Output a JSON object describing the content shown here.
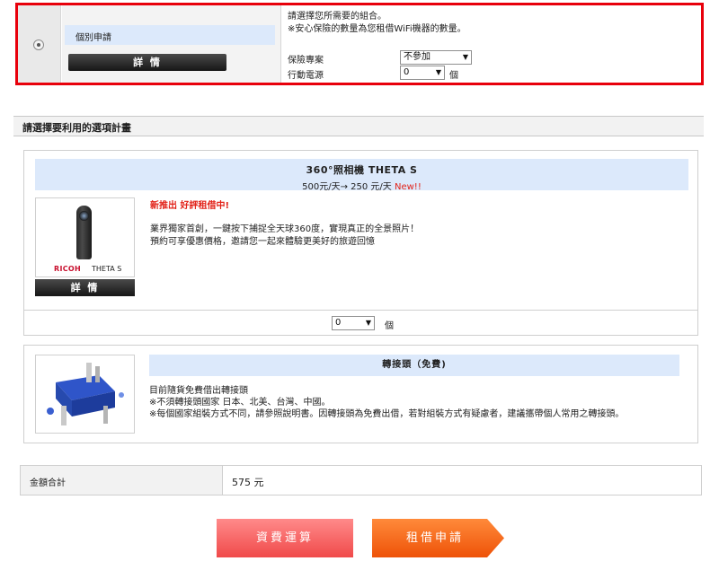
{
  "plan": {
    "name": "個別申請",
    "detail_label": "詳 情",
    "instruction_1": "請選擇您所需要的組合。",
    "instruction_2": "※安心保險的數量為您租借WiFi機器的數量。",
    "insurance_label": "保險專案",
    "insurance_value": "不參加",
    "battery_label": "行動電源",
    "battery_value": "0",
    "battery_unit": "個"
  },
  "options_section": {
    "title": "請選擇要利用的選項計畫"
  },
  "product": {
    "title": "360°照相機 THETA S",
    "price": "500元/天→ 250 元/天",
    "new_badge": "New!!",
    "image_brand": "RICOH",
    "image_model": "THETA S",
    "detail_label": "詳 情",
    "tagline": "新推出 好評租借中!",
    "desc_1": "業界獨家首創，一鍵按下捕捉全天球360度，實現真正的全景照片！",
    "desc_2": "預約可享優惠價格，邀請您一起來體驗更美好的旅遊回憶",
    "qty_value": "0",
    "qty_unit": "個"
  },
  "adapter": {
    "title": "轉接頭（免費)",
    "line_1": "目前隨貨免費借出轉接頭",
    "line_2": "※不須轉接頭國家 日本、北美、台灣、中國。",
    "line_3": "※每個國家組裝方式不同，請參照說明書。因轉接頭為免費出借，若對組裝方式有疑慮者，建議攜帶個人常用之轉接頭。"
  },
  "total": {
    "label": "金額合計",
    "value": "575 元"
  },
  "actions": {
    "calc_label": "資費運算",
    "apply_label": "租借申請"
  },
  "colors": {
    "highlight_border": "#e8000b",
    "header_blue": "#dce9fb",
    "accent_red": "#e2231a",
    "calc_button": "#f04a4a",
    "apply_button": "#f05a10"
  }
}
